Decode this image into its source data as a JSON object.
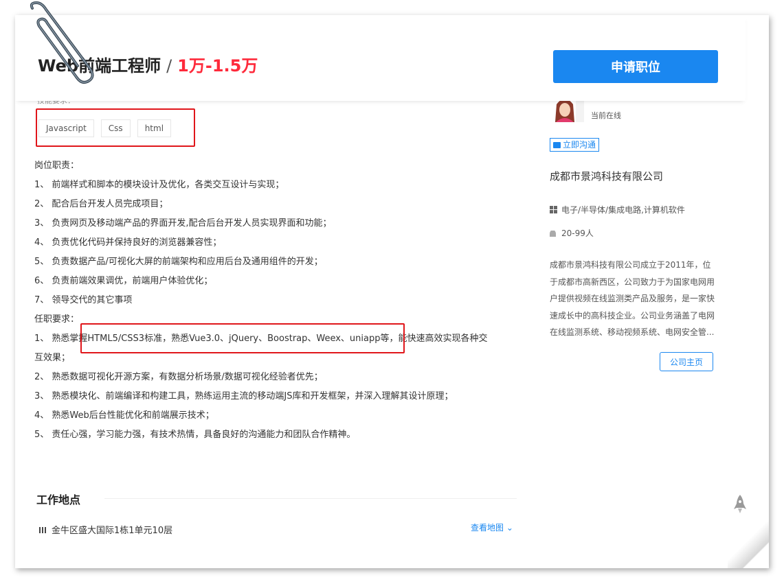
{
  "header": {
    "job_title": "Web前端工程师",
    "separator": "/",
    "salary": "1万-1.5万",
    "apply_label": "申请职位"
  },
  "skills": {
    "title": "技能要求：",
    "tags": [
      "Javascript",
      "Css",
      "html"
    ]
  },
  "description": {
    "lines": [
      "岗位职责：",
      "1、 前端样式和脚本的模块设计及优化，各类交互设计与实现；",
      "2、 配合后台开发人员完成项目；",
      "3、 负责网页及移动端产品的界面开发,配合后台开发人员实现界面和功能；",
      "4、 负责优化代码并保持良好的浏览器兼容性；",
      "5、 负责数据产品/可视化大屏的前端架构和应用后台及通用组件的开发；",
      "6、 负责前端效果调优，前端用户体验优化；",
      "7、 领导交代的其它事项",
      "任职要求：",
      "1、 熟悉掌握HTML5/CSS3标准，熟悉Vue3.0、jQuery、Boostrap、Weex、uniapp等，能快速高效实现各种交",
      "互效果；",
      "2、 熟悉数据可视化开源方案，有数据分析场景/数据可视化经验者优先；",
      "3、 熟悉模块化、前端编译和构建工具，熟练运用主流的移动端JS库和开发框架，并深入理解其设计原理；",
      "4、 熟悉Web后台性能优化和前端展示技术；",
      "5、 责任心强，学习能力强，有技术热情，具备良好的沟通能力和团队合作精神。"
    ]
  },
  "location": {
    "title": "工作地点",
    "address": "金牛区盛大国际1栋1单元10层",
    "map_link": "查看地图"
  },
  "sidebar": {
    "online_status": "当前在线",
    "chat_label": "立即沟通",
    "company_name": "成都市景鸿科技有限公司",
    "industry": "电子/半导体/集成电路,计算机软件",
    "size": "20-99人",
    "company_desc_lines": [
      "成都市景鸿科技有限公司成立于2011年，位",
      "于成都市高新西区，公司致力于为国家电网用",
      "户提供视频在线监测类产品及服务，是一家快",
      "速成长中的高科技企业。公司业务涵盖了电网",
      "在线监测系统、移动视频系统、电网安全管..."
    ],
    "home_label": "公司主页"
  },
  "colors": {
    "accent": "#1a87f0",
    "salary": "#fe2a3b",
    "highlight_box": "#e0151a"
  }
}
